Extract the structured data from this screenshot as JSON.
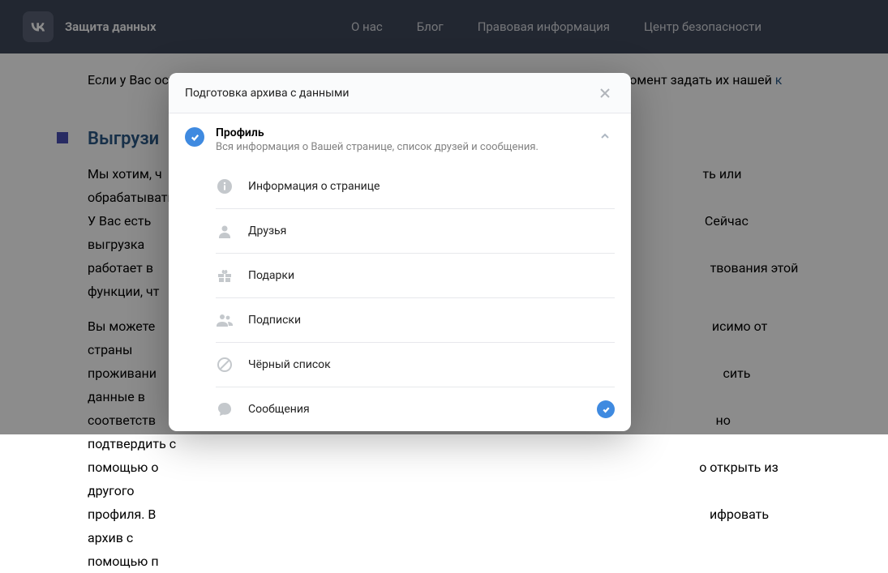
{
  "header": {
    "brand": "Защита данных",
    "nav": [
      {
        "label": "О нас"
      },
      {
        "label": "Блог"
      },
      {
        "label": "Правовая информация"
      },
      {
        "label": "Центр безопасности"
      }
    ]
  },
  "page": {
    "intro_before_link": "Если у Вас остались вопросы касательно приватности ВКонтакте, Вы можете в любой момент задать их нашей ",
    "intro_link": "к",
    "section_title": "Выгрузи",
    "p1": "Мы хотим, ч",
    "p1b": "ть или обрабатывать.",
    "p2": "У Вас есть ",
    "p2b": " Сейчас выгрузка",
    "p3": "работает в ",
    "p3b": "твования этой",
    "p4": "функции, чт",
    "p5": "Вы можете ",
    "p5b": "исимо от страны",
    "p6": "проживани",
    "p6b": "сить данные в",
    "p7": "соответств",
    "p7b": "но подтвердить с",
    "p8": "помощью о",
    "p8b": "о открыть из другого",
    "p9": "профиля. В",
    "p9b": "ифровать архив с",
    "p10": "помощью п"
  },
  "modal": {
    "title": "Подготовка архива с данными",
    "section": {
      "name": "Профиль",
      "desc": "Вся информация о Вашей странице, список друзей и сообщения."
    },
    "items": [
      {
        "label": "Информация о странице",
        "icon": "info",
        "checked": false
      },
      {
        "label": "Друзья",
        "icon": "user",
        "checked": false
      },
      {
        "label": "Подарки",
        "icon": "gift",
        "checked": false
      },
      {
        "label": "Подписки",
        "icon": "users",
        "checked": false
      },
      {
        "label": "Чёрный список",
        "icon": "ban",
        "checked": false
      },
      {
        "label": "Сообщения",
        "icon": "message",
        "checked": true
      }
    ]
  }
}
